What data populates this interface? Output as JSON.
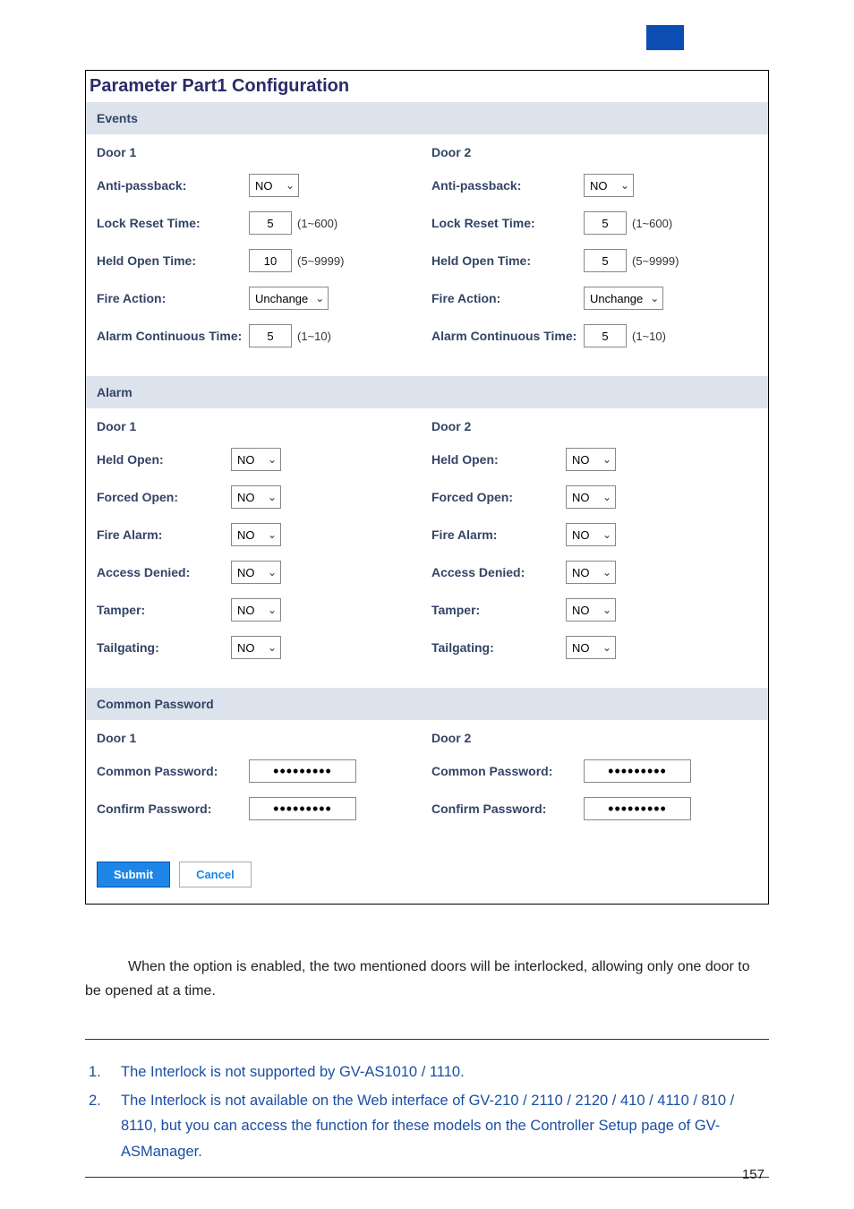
{
  "panel": {
    "title": "Parameter Part1 Configuration",
    "events": {
      "header": "Events",
      "door1": {
        "title": "Door 1",
        "anti_passback_label": "Anti-passback:",
        "anti_passback_value": "NO",
        "lock_reset_label": "Lock Reset Time:",
        "lock_reset_value": "5",
        "lock_reset_hint": "(1~600)",
        "held_open_label": "Held Open Time:",
        "held_open_value": "10",
        "held_open_hint": "(5~9999)",
        "fire_action_label": "Fire Action:",
        "fire_action_value": "Unchange",
        "alarm_cont_label": "Alarm Continuous Time:",
        "alarm_cont_value": "5",
        "alarm_cont_hint": "(1~10)"
      },
      "door2": {
        "title": "Door 2",
        "anti_passback_label": "Anti-passback:",
        "anti_passback_value": "NO",
        "lock_reset_label": "Lock Reset Time:",
        "lock_reset_value": "5",
        "lock_reset_hint": "(1~600)",
        "held_open_label": "Held Open Time:",
        "held_open_value": "5",
        "held_open_hint": "(5~9999)",
        "fire_action_label": "Fire Action:",
        "fire_action_value": "Unchange",
        "alarm_cont_label": "Alarm Continuous Time:",
        "alarm_cont_value": "5",
        "alarm_cont_hint": "(1~10)"
      }
    },
    "alarm": {
      "header": "Alarm",
      "door1": {
        "title": "Door 1",
        "held_open_label": "Held Open:",
        "held_open_value": "NO",
        "forced_open_label": "Forced Open:",
        "forced_open_value": "NO",
        "fire_alarm_label": "Fire Alarm:",
        "fire_alarm_value": "NO",
        "access_denied_label": "Access Denied:",
        "access_denied_value": "NO",
        "tamper_label": "Tamper:",
        "tamper_value": "NO",
        "tailgating_label": "Tailgating:",
        "tailgating_value": "NO"
      },
      "door2": {
        "title": "Door 2",
        "held_open_label": "Held Open:",
        "held_open_value": "NO",
        "forced_open_label": "Forced Open:",
        "forced_open_value": "NO",
        "fire_alarm_label": "Fire Alarm:",
        "fire_alarm_value": "NO",
        "access_denied_label": "Access Denied:",
        "access_denied_value": "NO",
        "tamper_label": "Tamper:",
        "tamper_value": "NO",
        "tailgating_label": "Tailgating:",
        "tailgating_value": "NO"
      }
    },
    "common_password": {
      "header": "Common Password",
      "door1": {
        "title": "Door 1",
        "common_label": "Common Password:",
        "common_value": "•••••••••",
        "confirm_label": "Confirm Password:",
        "confirm_value": "•••••••••"
      },
      "door2": {
        "title": "Door 2",
        "common_label": "Common Password:",
        "common_value": "•••••••••",
        "confirm_label": "Confirm Password:",
        "confirm_value": "•••••••••"
      }
    },
    "buttons": {
      "submit": "Submit",
      "cancel": "Cancel"
    }
  },
  "paragraph": "When the option is enabled, the two mentioned doors will be interlocked, allowing only one door to be opened at a time.",
  "notes": {
    "n1_num": "1.",
    "n1_text": "The Interlock is not supported by GV-AS1010 / 1110.",
    "n2_num": "2.",
    "n2_text": "The Interlock is not available on the Web interface of GV-210 / 2110 / 2120 / 410 / 4110 / 810 / 8110, but you can access the function for these models on the Controller Setup page of GV-ASManager."
  },
  "page_number": "157"
}
